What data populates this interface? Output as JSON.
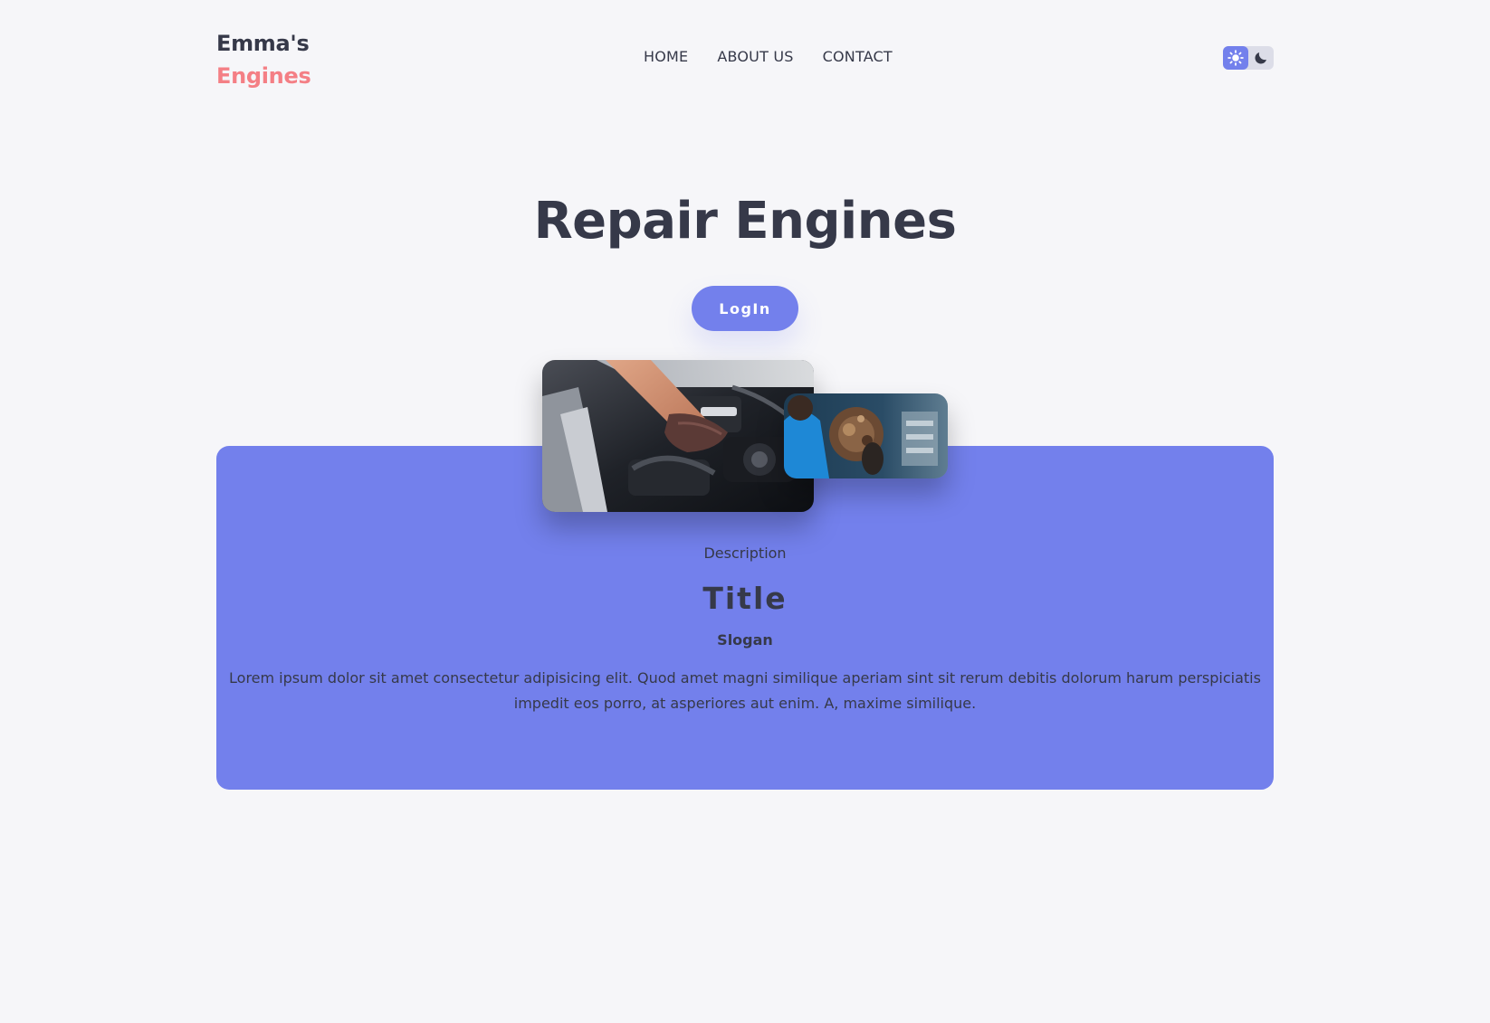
{
  "brand": {
    "line1": "Emma's",
    "line2": "Engines"
  },
  "nav": {
    "items": [
      {
        "label": "HOME"
      },
      {
        "label": "ABOUT US"
      },
      {
        "label": "CONTACT"
      }
    ]
  },
  "theme_toggle": {
    "options": [
      "sun-icon",
      "moon-icon"
    ],
    "active": "sun-icon",
    "accent": "#7380ec"
  },
  "hero": {
    "title": "Repair Engines",
    "login_label": "LogIn"
  },
  "card": {
    "description": "Description",
    "title": "Title",
    "slogan": "Slogan",
    "text": "Lorem ipsum dolor sit amet consectetur adipisicing elit. Quod amet magni similique aperiam sint sit rerum debitis dolorum harum perspiciatis impedit eos porro, at asperiores aut enim. A, maxime similique."
  },
  "photos": [
    {
      "name": "engine-bay-photo"
    },
    {
      "name": "mechanic-photo"
    }
  ],
  "colors": {
    "background": "#f6f6f9",
    "primary": "#7380ec",
    "dark_text": "#363949",
    "brand_accent": "#f47f85"
  }
}
